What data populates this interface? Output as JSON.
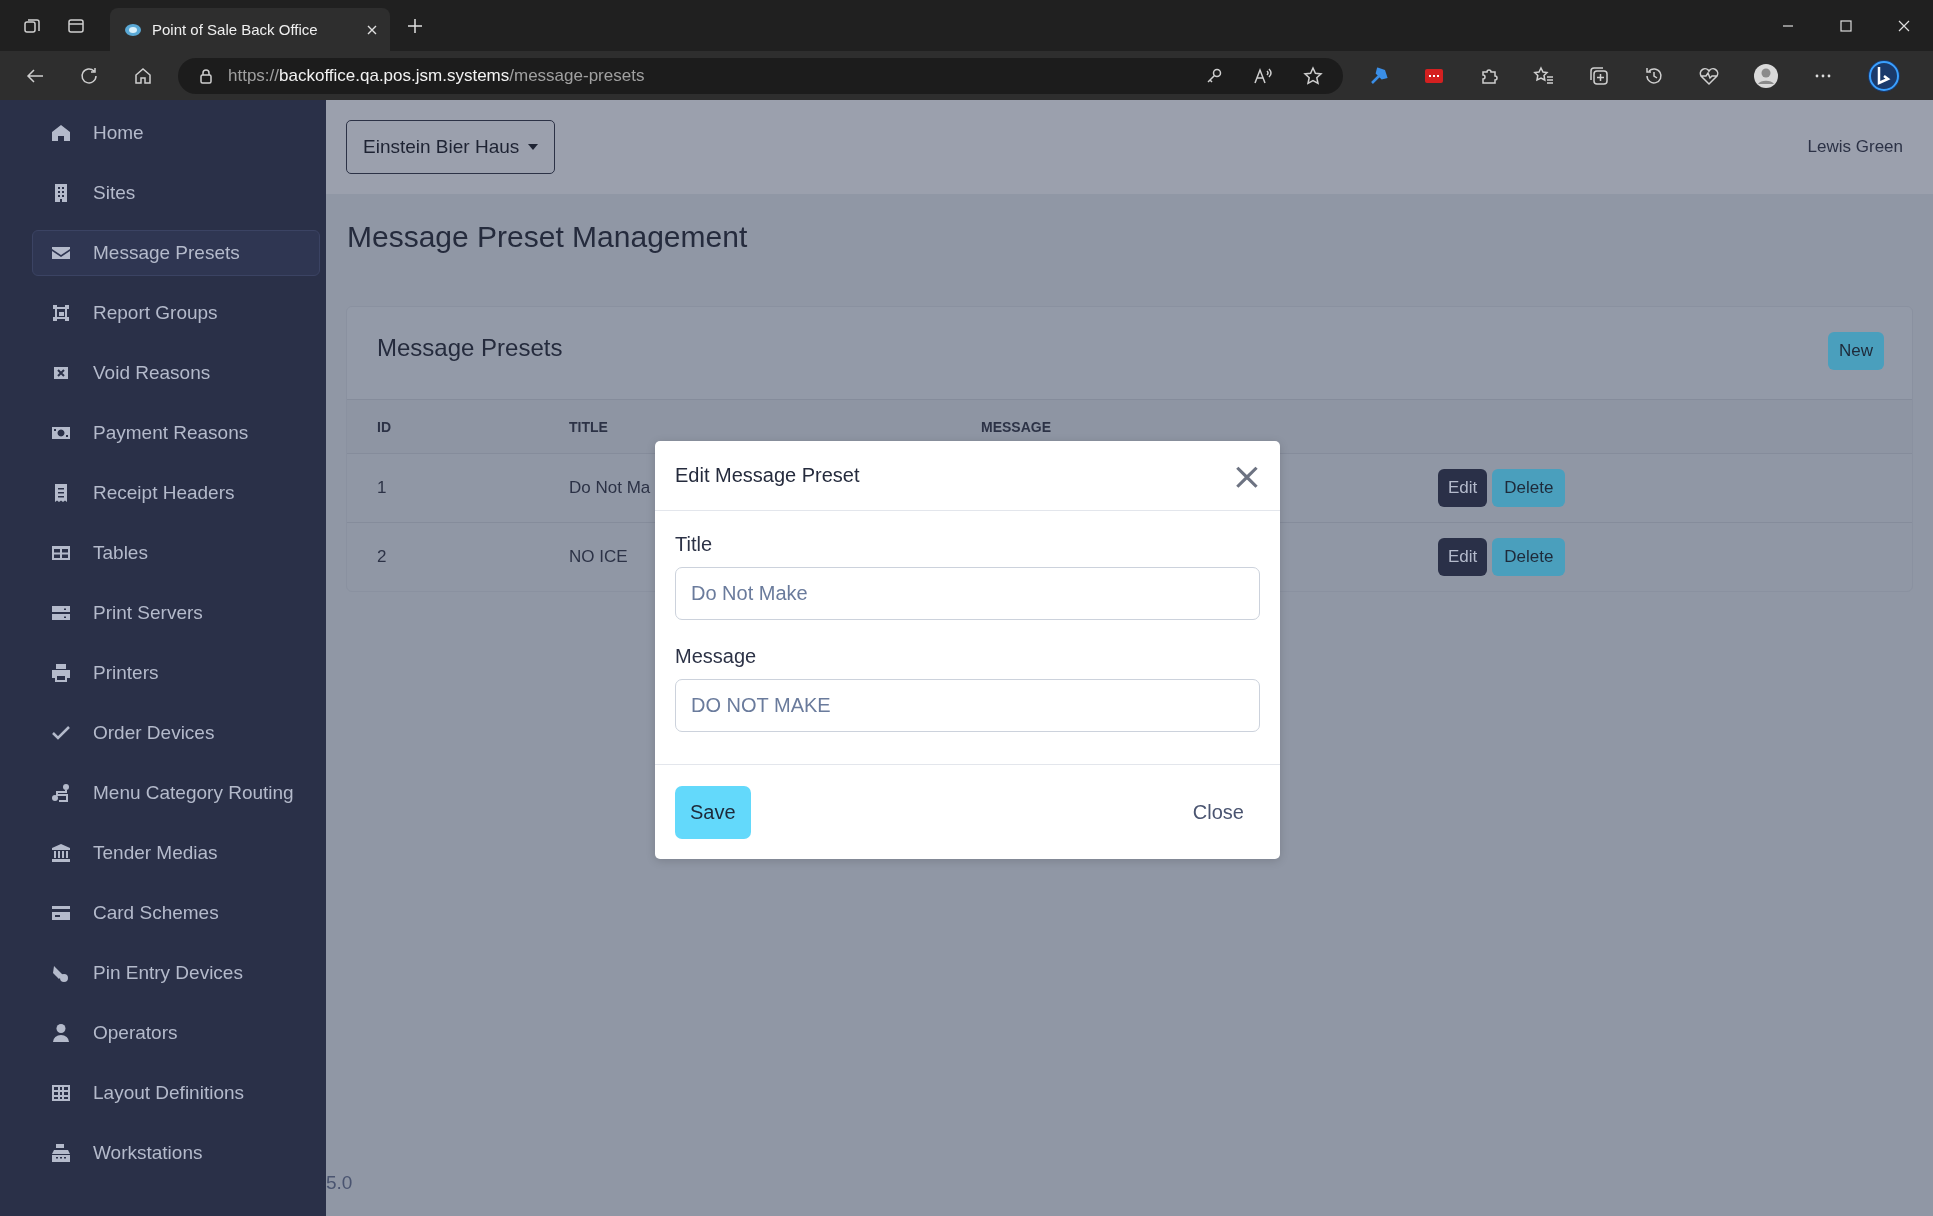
{
  "browser": {
    "tab_title": "Point of Sale Back Office",
    "url": {
      "scheme": "https://",
      "host": "backoffice.qa.pos.jsm.systems",
      "path": "/message-presets"
    }
  },
  "sidebar": {
    "items": [
      {
        "label": "Home",
        "selected": false
      },
      {
        "label": "Sites",
        "selected": false
      },
      {
        "label": "Message Presets",
        "selected": true
      },
      {
        "label": "Report Groups",
        "selected": false
      },
      {
        "label": "Void Reasons",
        "selected": false
      },
      {
        "label": "Payment Reasons",
        "selected": false
      },
      {
        "label": "Receipt Headers",
        "selected": false
      },
      {
        "label": "Tables",
        "selected": false
      },
      {
        "label": "Print Servers",
        "selected": false
      },
      {
        "label": "Printers",
        "selected": false
      },
      {
        "label": "Order Devices",
        "selected": false
      },
      {
        "label": "Menu Category Routing",
        "selected": false
      },
      {
        "label": "Tender Medias",
        "selected": false
      },
      {
        "label": "Card Schemes",
        "selected": false
      },
      {
        "label": "Pin Entry Devices",
        "selected": false
      },
      {
        "label": "Operators",
        "selected": false
      },
      {
        "label": "Layout Definitions",
        "selected": false
      },
      {
        "label": "Workstations",
        "selected": false
      }
    ]
  },
  "header": {
    "site_dropdown": "Einstein Bier Haus",
    "user": "Lewis Green"
  },
  "page_title": "Message Preset Management",
  "card": {
    "title": "Message Presets",
    "new_button": "New",
    "table": {
      "columns": [
        "ID",
        "TITLE",
        "MESSAGE"
      ],
      "rows": [
        {
          "id": "1",
          "title": "Do Not Ma",
          "actions": [
            "Edit",
            "Delete"
          ]
        },
        {
          "id": "2",
          "title": "NO ICE",
          "actions": [
            "Edit",
            "Delete"
          ]
        }
      ]
    }
  },
  "version": "5.0",
  "modal": {
    "title": "Edit Message Preset",
    "close_icon": "×",
    "fields": [
      {
        "label": "Title",
        "value": "Do Not Make"
      },
      {
        "label": "Message",
        "value": "DO NOT MAKE"
      }
    ],
    "save_button": "Save",
    "close_button": "Close"
  }
}
